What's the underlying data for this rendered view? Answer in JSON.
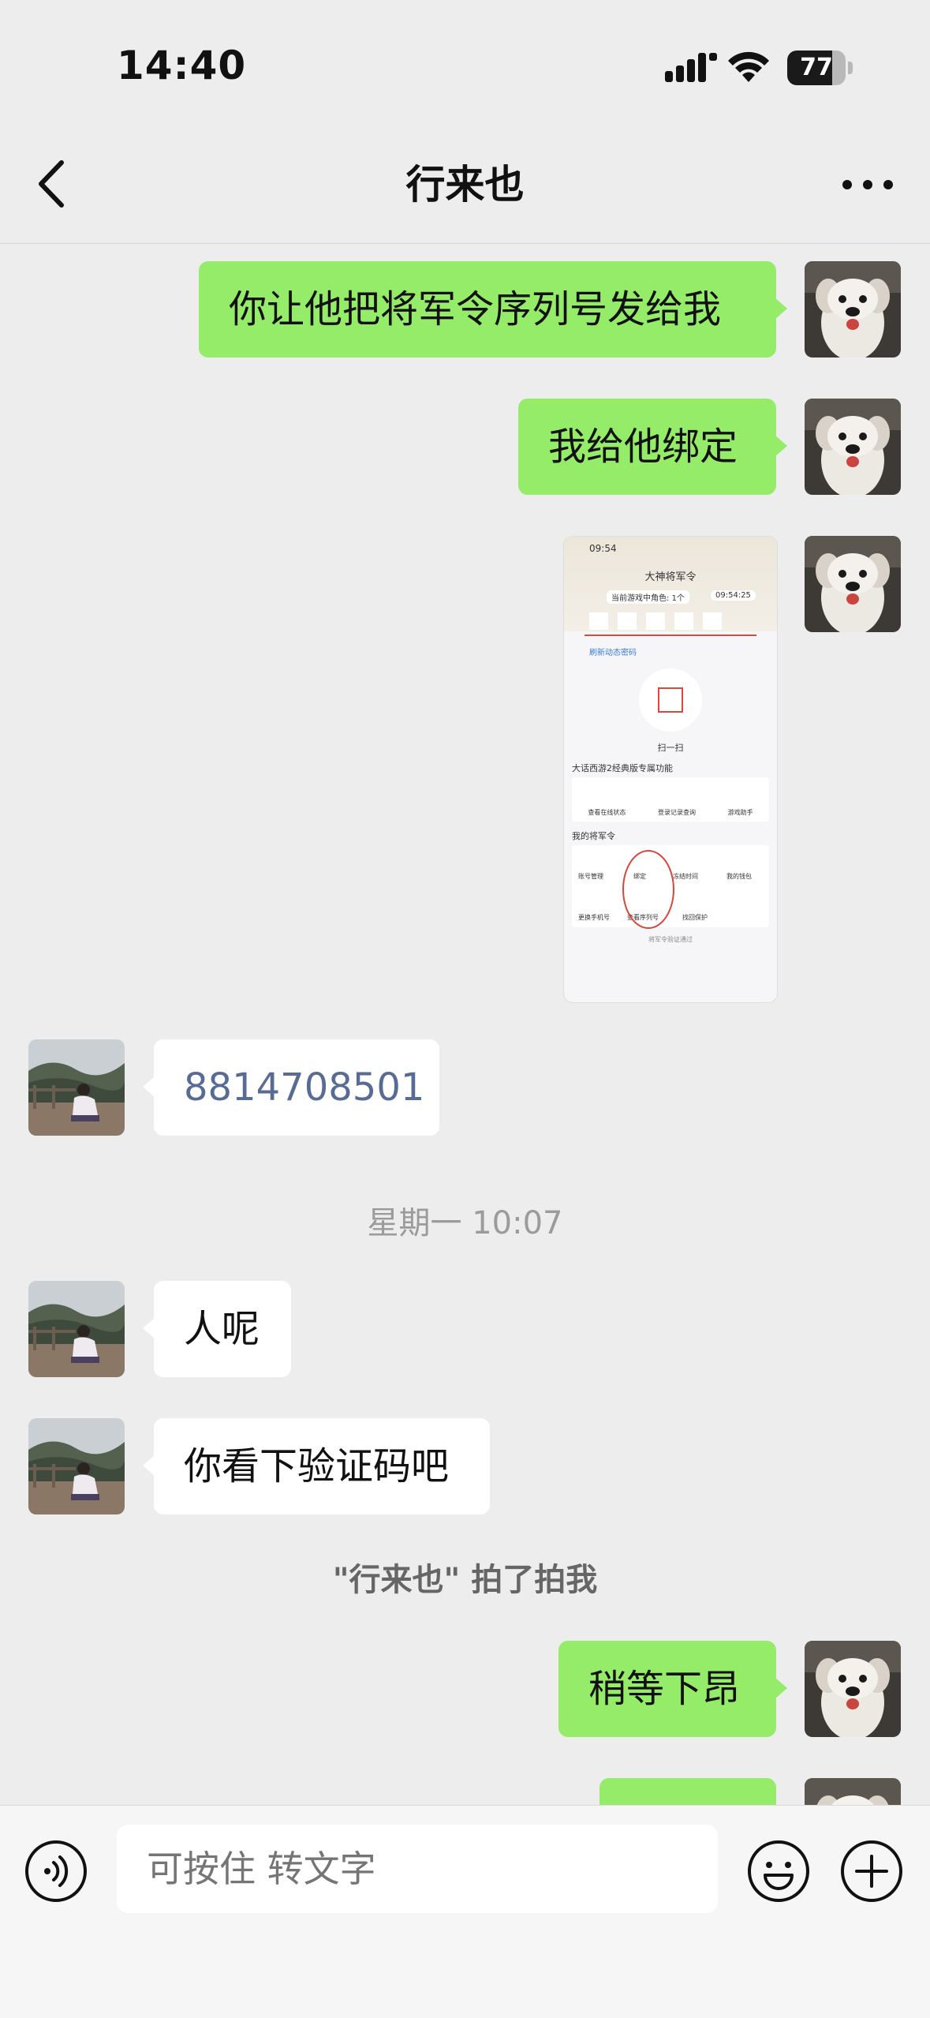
{
  "status_bar": {
    "time": "14:40",
    "battery": "77",
    "battery_level": 0.77
  },
  "header": {
    "title": "行来也"
  },
  "messages": {
    "m1": "你让他把将军令序列号发给我",
    "m2": "我给他绑定",
    "m4": "8814708501",
    "timestamp": "星期一 10:07",
    "m5": "人呢",
    "m6": "你看下验证码吧",
    "pat": "\"行来也\" 拍了拍我",
    "m7": "稍等下昂"
  },
  "screenshot_image": {
    "time": "09:54",
    "title": "大神将军令",
    "account_hint": "当前游戏中角色: 1个",
    "clock": "09:54:25",
    "refresh": "刷新动态密码",
    "scan": "扫一扫",
    "section1": "大话西游2经典版专属功能",
    "tools1": [
      "查看在线状态",
      "登录记录查询",
      "游戏助手"
    ],
    "section2": "我的将军令",
    "tools2": [
      "账号管理",
      "绑定",
      "冻结时间",
      "我的钱包",
      "更换手机号",
      "查看序列号",
      "找回保护"
    ],
    "footer": "将军令验证通过"
  },
  "input": {
    "placeholder": "可按住 转文字"
  },
  "colors": {
    "outgoing_bubble": "#95ec69",
    "incoming_bubble": "#ffffff",
    "background": "#ededed",
    "link_number": "#576b95"
  }
}
